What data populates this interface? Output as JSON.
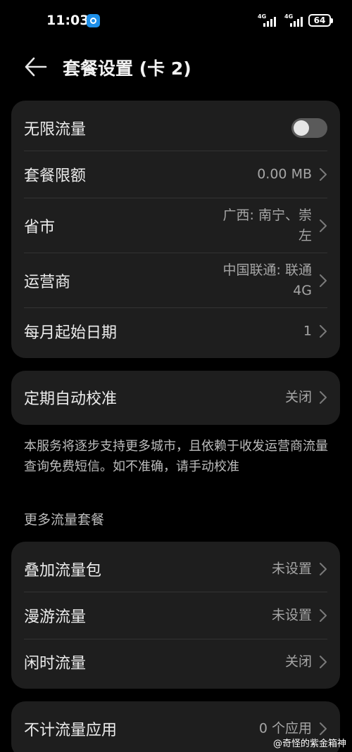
{
  "status_bar": {
    "time": "11:03",
    "network_1": "4G",
    "network_2": "4G",
    "battery": "64"
  },
  "header": {
    "title": "套餐设置 (卡 2)"
  },
  "card1": {
    "unlimited": {
      "label": "无限流量",
      "enabled": false
    },
    "plan_limit": {
      "label": "套餐限额",
      "value": "0.00 MB"
    },
    "province_city": {
      "label": "省市",
      "value": "广西: 南宁、崇\n左"
    },
    "carrier": {
      "label": "运营商",
      "value": "中国联通: 联通\n4G"
    },
    "monthly_start": {
      "label": "每月起始日期",
      "value": "1"
    }
  },
  "card2": {
    "auto_calibrate": {
      "label": "定期自动校准",
      "value": "关闭"
    }
  },
  "note": "本服务将逐步支持更多城市，且依赖于收发运营商流量查询免费短信。如不准确，请手动校准",
  "more_section_title": "更多流量套餐",
  "card3": {
    "addon_package": {
      "label": "叠加流量包",
      "value": "未设置"
    },
    "roaming": {
      "label": "漫游流量",
      "value": "未设置"
    },
    "idle_time": {
      "label": "闲时流量",
      "value": "关闭"
    }
  },
  "card4": {
    "unmetered_apps": {
      "label": "不计流量应用",
      "value": "0 个应用"
    }
  },
  "watermark": "@奇怪的紫金箱神",
  "colors": {
    "background": "#000000",
    "card": "#1e1e1e",
    "toggle_off": "#5a5a5a"
  }
}
